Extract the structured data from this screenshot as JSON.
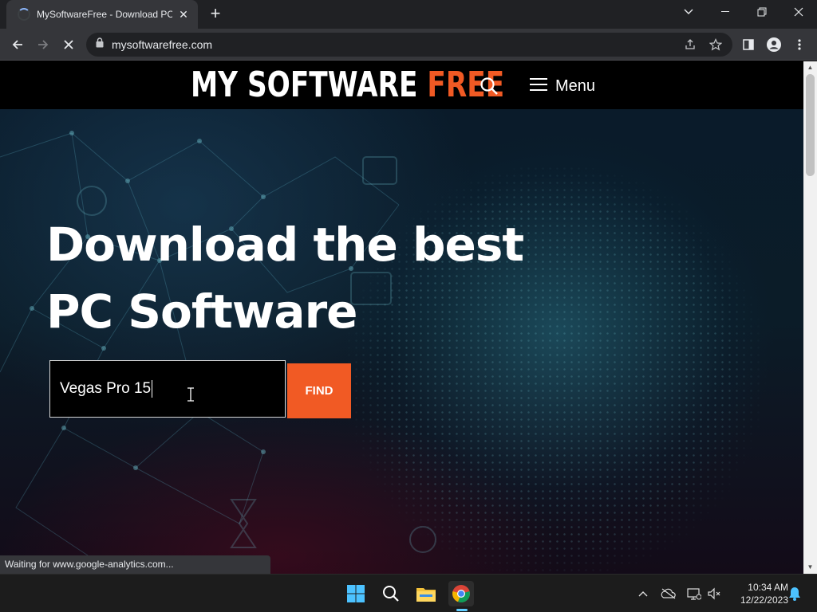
{
  "browser": {
    "tab_title": "MySoftwareFree - Download PC S",
    "url": "mysoftwarefree.com",
    "status_text": "Waiting for www.google-analytics.com..."
  },
  "site": {
    "logo_white": "MY SOFTWARE ",
    "logo_orange": "FREE",
    "menu_label": "Menu",
    "hero_line1": "Download the best",
    "hero_line2": "PC Software",
    "search_value": "Vegas Pro 15",
    "find_label": "FIND",
    "accent_color": "#f15a24"
  },
  "taskbar": {
    "time": "10:34 AM",
    "date": "12/22/2023",
    "apps": [
      "windows-start-icon",
      "search-icon",
      "file-explorer-icon",
      "chrome-icon"
    ]
  }
}
